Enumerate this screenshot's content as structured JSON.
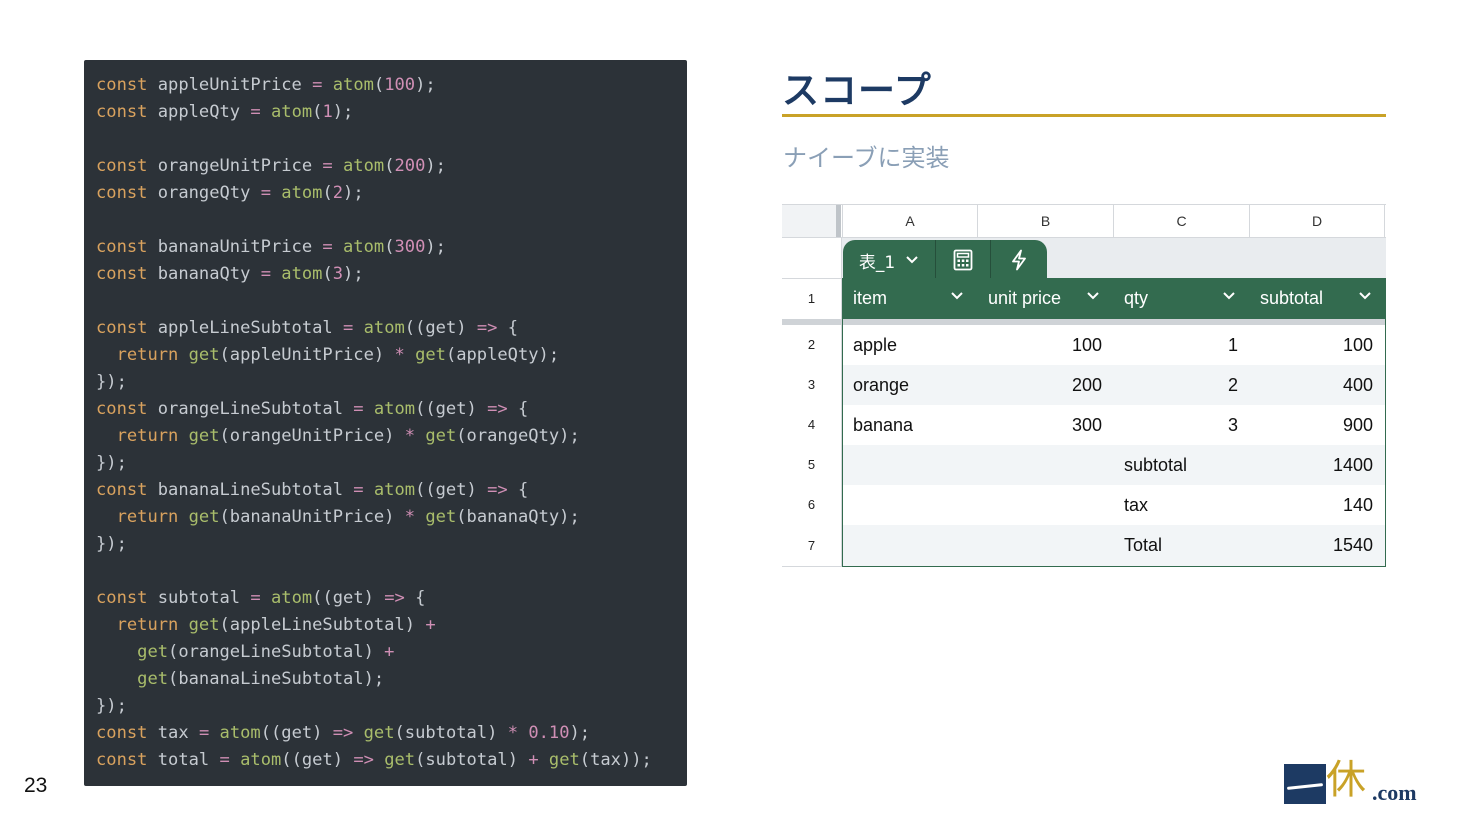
{
  "slide": {
    "page_number": "23",
    "title": "スコープ",
    "subtitle": "ナイーブに実装",
    "logo": {
      "kanji": "休",
      "suffix": ".com"
    }
  },
  "code": {
    "lines": [
      [
        [
          "kw",
          "const"
        ],
        [
          "id",
          " appleUnitPrice "
        ],
        [
          "op",
          "="
        ],
        [
          "id",
          " "
        ],
        [
          "fn",
          "atom"
        ],
        [
          "id",
          "("
        ],
        [
          "num",
          "100"
        ],
        [
          "id",
          ");"
        ]
      ],
      [
        [
          "kw",
          "const"
        ],
        [
          "id",
          " appleQty "
        ],
        [
          "op",
          "="
        ],
        [
          "id",
          " "
        ],
        [
          "fn",
          "atom"
        ],
        [
          "id",
          "("
        ],
        [
          "num",
          "1"
        ],
        [
          "id",
          ");"
        ]
      ],
      [],
      [
        [
          "kw",
          "const"
        ],
        [
          "id",
          " orangeUnitPrice "
        ],
        [
          "op",
          "="
        ],
        [
          "id",
          " "
        ],
        [
          "fn",
          "atom"
        ],
        [
          "id",
          "("
        ],
        [
          "num",
          "200"
        ],
        [
          "id",
          ");"
        ]
      ],
      [
        [
          "kw",
          "const"
        ],
        [
          "id",
          " orangeQty "
        ],
        [
          "op",
          "="
        ],
        [
          "id",
          " "
        ],
        [
          "fn",
          "atom"
        ],
        [
          "id",
          "("
        ],
        [
          "num",
          "2"
        ],
        [
          "id",
          ");"
        ]
      ],
      [],
      [
        [
          "kw",
          "const"
        ],
        [
          "id",
          " bananaUnitPrice "
        ],
        [
          "op",
          "="
        ],
        [
          "id",
          " "
        ],
        [
          "fn",
          "atom"
        ],
        [
          "id",
          "("
        ],
        [
          "num",
          "300"
        ],
        [
          "id",
          ");"
        ]
      ],
      [
        [
          "kw",
          "const"
        ],
        [
          "id",
          " bananaQty "
        ],
        [
          "op",
          "="
        ],
        [
          "id",
          " "
        ],
        [
          "fn",
          "atom"
        ],
        [
          "id",
          "("
        ],
        [
          "num",
          "3"
        ],
        [
          "id",
          ");"
        ]
      ],
      [],
      [
        [
          "kw",
          "const"
        ],
        [
          "id",
          " appleLineSubtotal "
        ],
        [
          "op",
          "="
        ],
        [
          "id",
          " "
        ],
        [
          "fn",
          "atom"
        ],
        [
          "id",
          "((get) "
        ],
        [
          "op",
          "=>"
        ],
        [
          "id",
          " {"
        ]
      ],
      [
        [
          "id",
          "  "
        ],
        [
          "kw",
          "return"
        ],
        [
          "id",
          " "
        ],
        [
          "fn",
          "get"
        ],
        [
          "id",
          "(appleUnitPrice) "
        ],
        [
          "op",
          "*"
        ],
        [
          "id",
          " "
        ],
        [
          "fn",
          "get"
        ],
        [
          "id",
          "(appleQty);"
        ]
      ],
      [
        [
          "id",
          "});"
        ]
      ],
      [
        [
          "kw",
          "const"
        ],
        [
          "id",
          " orangeLineSubtotal "
        ],
        [
          "op",
          "="
        ],
        [
          "id",
          " "
        ],
        [
          "fn",
          "atom"
        ],
        [
          "id",
          "((get) "
        ],
        [
          "op",
          "=>"
        ],
        [
          "id",
          " {"
        ]
      ],
      [
        [
          "id",
          "  "
        ],
        [
          "kw",
          "return"
        ],
        [
          "id",
          " "
        ],
        [
          "fn",
          "get"
        ],
        [
          "id",
          "(orangeUnitPrice) "
        ],
        [
          "op",
          "*"
        ],
        [
          "id",
          " "
        ],
        [
          "fn",
          "get"
        ],
        [
          "id",
          "(orangeQty);"
        ]
      ],
      [
        [
          "id",
          "});"
        ]
      ],
      [
        [
          "kw",
          "const"
        ],
        [
          "id",
          " bananaLineSubtotal "
        ],
        [
          "op",
          "="
        ],
        [
          "id",
          " "
        ],
        [
          "fn",
          "atom"
        ],
        [
          "id",
          "((get) "
        ],
        [
          "op",
          "=>"
        ],
        [
          "id",
          " {"
        ]
      ],
      [
        [
          "id",
          "  "
        ],
        [
          "kw",
          "return"
        ],
        [
          "id",
          " "
        ],
        [
          "fn",
          "get"
        ],
        [
          "id",
          "(bananaUnitPrice) "
        ],
        [
          "op",
          "*"
        ],
        [
          "id",
          " "
        ],
        [
          "fn",
          "get"
        ],
        [
          "id",
          "(bananaQty);"
        ]
      ],
      [
        [
          "id",
          "});"
        ]
      ],
      [],
      [
        [
          "kw",
          "const"
        ],
        [
          "id",
          " subtotal "
        ],
        [
          "op",
          "="
        ],
        [
          "id",
          " "
        ],
        [
          "fn",
          "atom"
        ],
        [
          "id",
          "((get) "
        ],
        [
          "op",
          "=>"
        ],
        [
          "id",
          " {"
        ]
      ],
      [
        [
          "id",
          "  "
        ],
        [
          "kw",
          "return"
        ],
        [
          "id",
          " "
        ],
        [
          "fn",
          "get"
        ],
        [
          "id",
          "(appleLineSubtotal) "
        ],
        [
          "op",
          "+"
        ]
      ],
      [
        [
          "id",
          "    "
        ],
        [
          "fn",
          "get"
        ],
        [
          "id",
          "(orangeLineSubtotal) "
        ],
        [
          "op",
          "+"
        ]
      ],
      [
        [
          "id",
          "    "
        ],
        [
          "fn",
          "get"
        ],
        [
          "id",
          "(bananaLineSubtotal);"
        ]
      ],
      [
        [
          "id",
          "});"
        ]
      ],
      [
        [
          "kw",
          "const"
        ],
        [
          "id",
          " tax "
        ],
        [
          "op",
          "="
        ],
        [
          "id",
          " "
        ],
        [
          "fn",
          "atom"
        ],
        [
          "id",
          "((get) "
        ],
        [
          "op",
          "=>"
        ],
        [
          "id",
          " "
        ],
        [
          "fn",
          "get"
        ],
        [
          "id",
          "(subtotal) "
        ],
        [
          "op",
          "*"
        ],
        [
          "id",
          " "
        ],
        [
          "num",
          "0.10"
        ],
        [
          "id",
          ");"
        ]
      ],
      [
        [
          "kw",
          "const"
        ],
        [
          "id",
          " total "
        ],
        [
          "op",
          "="
        ],
        [
          "id",
          " "
        ],
        [
          "fn",
          "atom"
        ],
        [
          "id",
          "((get) "
        ],
        [
          "op",
          "=>"
        ],
        [
          "id",
          " "
        ],
        [
          "fn",
          "get"
        ],
        [
          "id",
          "(subtotal) "
        ],
        [
          "op",
          "+"
        ],
        [
          "id",
          " "
        ],
        [
          "fn",
          "get"
        ],
        [
          "id",
          "(tax));"
        ]
      ]
    ]
  },
  "sheet": {
    "column_letters": [
      "A",
      "B",
      "C",
      "D"
    ],
    "table_tab": {
      "name": "表_1",
      "icons": [
        "chevron-down-icon",
        "calculator-icon",
        "lightning-icon"
      ]
    },
    "row_numbers": [
      "1",
      "2",
      "3",
      "4",
      "5",
      "6",
      "7"
    ],
    "headers": [
      "item",
      "unit price",
      "qty",
      "subtotal"
    ],
    "rows": [
      [
        "apple",
        "100",
        "1",
        "100"
      ],
      [
        "orange",
        "200",
        "2",
        "400"
      ],
      [
        "banana",
        "300",
        "3",
        "900"
      ],
      [
        "",
        "",
        "subtotal",
        "1400"
      ],
      [
        "",
        "",
        "tax",
        "140"
      ],
      [
        "",
        "",
        "Total",
        "1540"
      ]
    ],
    "colors": {
      "table_green": "#336b4f",
      "accent_gold": "#c9a227",
      "title_navy": "#1d3a63"
    }
  }
}
